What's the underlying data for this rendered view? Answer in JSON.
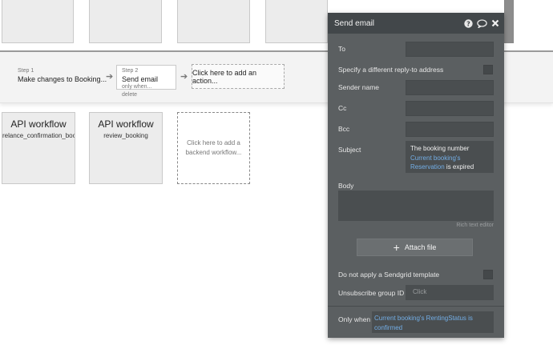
{
  "canvas": {
    "steps": [
      {
        "num": "Step 1",
        "title": "Make changes to Booking...",
        "meta": []
      },
      {
        "num": "Step 2",
        "title": "Send email",
        "meta": [
          "only when...",
          "delete"
        ]
      }
    ],
    "add_action": "Click here to add an action...",
    "api_workflows": [
      {
        "title": "API workflow",
        "name": "relance_confirmation_booking"
      },
      {
        "title": "API workflow",
        "name": "review_booking"
      }
    ],
    "add_backend": "Click here to add a backend workflow..."
  },
  "panel": {
    "title": "Send email",
    "icons": [
      "help-icon",
      "comment-icon",
      "close-icon"
    ],
    "to_label": "To",
    "to_value": "",
    "reply_to_label": "Specify a different reply-to address",
    "sender_label": "Sender name",
    "cc_label": "Cc",
    "bcc_label": "Bcc",
    "subject_label": "Subject",
    "subject_prefix": "The booking number",
    "subject_dynamic": "Current booking's Reservation",
    "subject_suffix": "is expired",
    "body_label": "Body",
    "rich_text": "Rich text editor",
    "attach_label": "Attach file",
    "sendgrid_label": "Do not apply a Sendgrid template",
    "unsub_label": "Unsubscribe group ID",
    "unsub_placeholder": "Click",
    "only_when_label": "Only when",
    "only_when_value": "Current booking's RentingStatus is confirmed"
  },
  "colors": {
    "panel_bg": "#5b5f61",
    "panel_header": "#42474a",
    "field_bg": "#4a4e50",
    "dynamic_text": "#73aee6"
  }
}
